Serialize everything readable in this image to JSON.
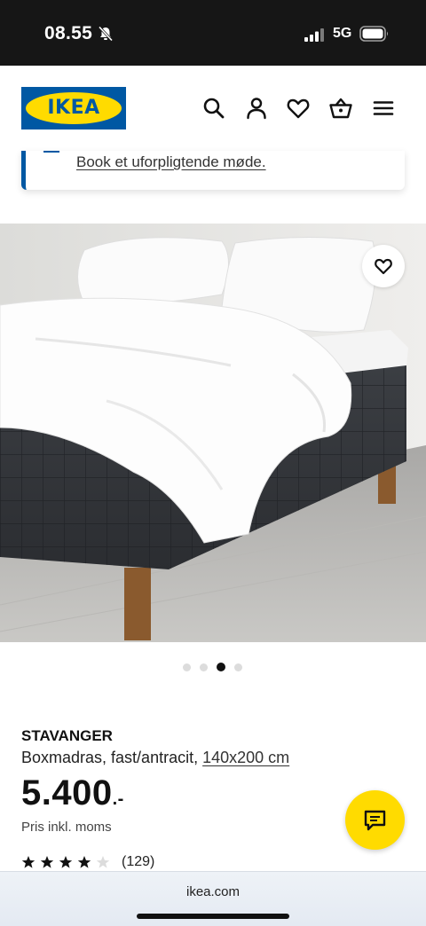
{
  "status_bar": {
    "time": "08.55",
    "network": "5G",
    "icons": [
      "bell-muted-icon",
      "signal-icon",
      "battery-icon"
    ]
  },
  "header": {
    "logo_text": "IKEA",
    "icons": [
      "search-icon",
      "account-icon",
      "heart-icon",
      "basket-icon",
      "menu-icon"
    ]
  },
  "promo": {
    "link_text": "Book et uforpligtende møde."
  },
  "gallery": {
    "image": "bed-product-photo",
    "slide_count": 4,
    "active_slide": 3
  },
  "product": {
    "name": "STAVANGER",
    "description": "Boxmadras, fast/antracit,",
    "size": "140x200 cm",
    "price": "5.400",
    "price_suffix": ".-",
    "price_note": "Pris inkl. moms",
    "rating": 4,
    "rating_max": 5,
    "review_count": "(129)"
  },
  "browser": {
    "url": "ikea.com"
  },
  "colors": {
    "brand_blue": "#0058a3",
    "brand_yellow": "#ffdb00",
    "status_bar": "#161616"
  }
}
